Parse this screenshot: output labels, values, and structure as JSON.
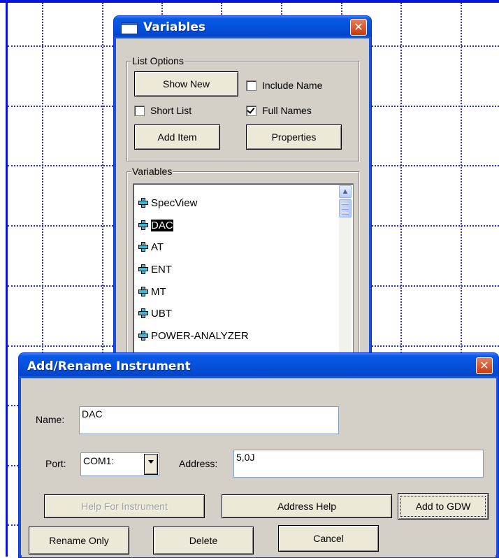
{
  "variables_window": {
    "title": "Variables",
    "close_icon": "close-icon",
    "list_options": {
      "group_label": "List Options",
      "show_new_label": "Show New",
      "include_name_label": "Include Name",
      "include_name_checked": false,
      "short_list_label": "Short List",
      "short_list_checked": false,
      "full_names_label": "Full Names",
      "full_names_checked": true,
      "add_item_label": "Add Item",
      "properties_label": "Properties"
    },
    "variables_group": {
      "group_label": "Variables",
      "items": [
        {
          "label": "SpecView",
          "icon": "plus-icon",
          "selected": false
        },
        {
          "label": "DAC",
          "icon": "plus-icon",
          "selected": true
        },
        {
          "label": "AT",
          "icon": "plus-icon",
          "selected": false
        },
        {
          "label": "ENT",
          "icon": "plus-icon",
          "selected": false
        },
        {
          "label": "MT",
          "icon": "plus-icon",
          "selected": false
        },
        {
          "label": "UBT",
          "icon": "plus-icon",
          "selected": false
        },
        {
          "label": "POWER-ANALYZER",
          "icon": "plus-icon",
          "selected": false
        }
      ]
    }
  },
  "instrument_dialog": {
    "title": "Add/Rename Instrument",
    "name_label": "Name:",
    "name_value": "DAC",
    "port_label": "Port:",
    "port_value": "COM1:",
    "address_label": "Address:",
    "address_value": "5,0J",
    "help_for_instrument_label": "Help For Instrument",
    "address_help_label": "Address Help",
    "add_to_gdw_label": "Add to GDW",
    "rename_only_label": "Rename Only",
    "delete_label": "Delete",
    "cancel_label": "Cancel"
  },
  "colors": {
    "titlebar_blue": "#0451dd",
    "grid_blue": "#2a30c8",
    "dialog_face": "#d4d0c8",
    "close_red": "#c63a12"
  }
}
